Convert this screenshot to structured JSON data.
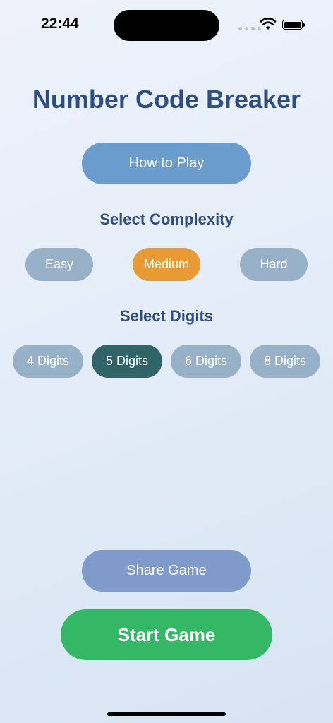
{
  "status_bar": {
    "time": "22:44"
  },
  "title": "Number Code Breaker",
  "how_to_play": "How to Play",
  "complexity": {
    "label": "Select Complexity",
    "options": [
      "Easy",
      "Medium",
      "Hard"
    ],
    "selected": "Medium"
  },
  "digits": {
    "label": "Select Digits",
    "options": [
      "4 Digits",
      "5 Digits",
      "6 Digits",
      "8 Digits"
    ],
    "selected": "5 Digits"
  },
  "share_game": "Share Game",
  "start_game": "Start Game",
  "colors": {
    "title": "#2f4f82",
    "how_to_play_bg": "#6a9dcd",
    "option_bg": "#97b1c9",
    "complexity_selected_bg": "#e99b33",
    "digits_selected_bg": "#2f6469",
    "share_bg": "#7f9bcc",
    "start_bg": "#35b865"
  },
  "icons": {
    "signal": "cellular-signal-icon",
    "wifi": "wifi-icon",
    "battery": "battery-icon"
  }
}
